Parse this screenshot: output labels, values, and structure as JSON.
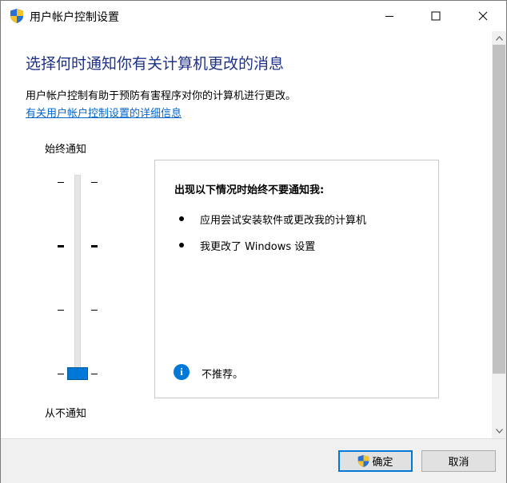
{
  "window": {
    "title": "用户帐户控制设置",
    "icon": "uac-shield-icon"
  },
  "content": {
    "heading": "选择何时通知你有关计算机更改的消息",
    "description": "用户帐户控制有助于预防有害程序对你的计算机进行更改。",
    "link": "有关用户帐户控制设置的详细信息"
  },
  "slider": {
    "top_label": "始终通知",
    "bottom_label": "从不通知",
    "levels": 4,
    "selected_level": 1
  },
  "panel": {
    "title": "出现以下情况时始终不要通知我:",
    "items": [
      "应用尝试安装软件或更改我的计算机",
      "我更改了 Windows 设置"
    ],
    "info_icon": "info-icon",
    "info_text": "不推荐。"
  },
  "buttons": {
    "ok": "确定",
    "cancel": "取消"
  },
  "colors": {
    "heading": "#1e3287",
    "link": "#0066cc",
    "accent": "#0078d7"
  }
}
